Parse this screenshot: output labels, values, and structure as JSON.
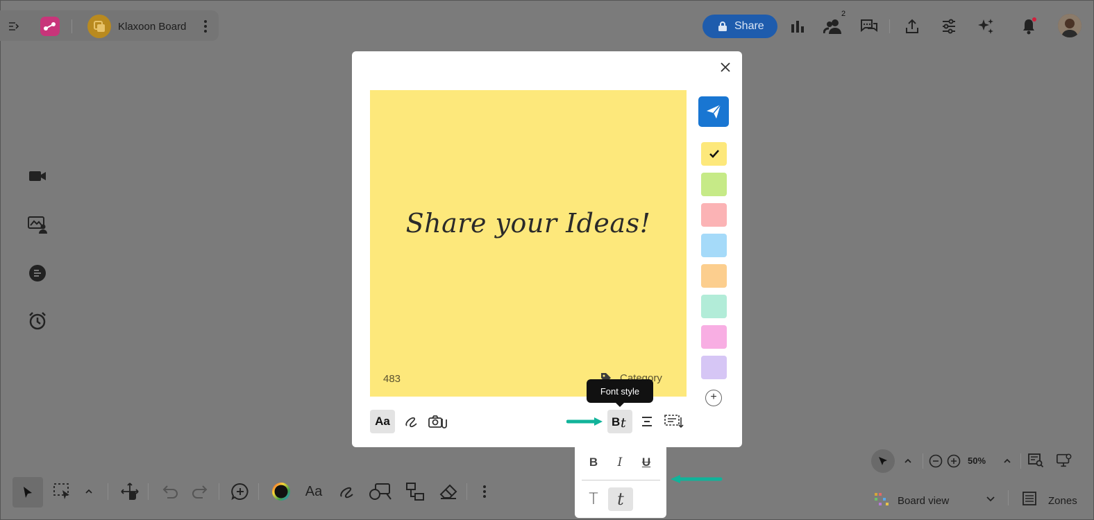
{
  "header": {
    "board_name": "Klaxoon Board",
    "share_label": "Share",
    "participants_count": "2"
  },
  "modal": {
    "sticky_text": "Share your Ideas!",
    "char_counter": "483",
    "category_label": "Category",
    "tooltip": "Font style",
    "text_button_label": "Aa",
    "colors": [
      "#fde87b",
      "#c6ea87",
      "#fbb3b5",
      "#a5daf9",
      "#fcce8e",
      "#b2ecd8",
      "#f8aee3",
      "#d6c6f5"
    ],
    "selected_color_index": 0
  },
  "font_popup": {
    "bold": "B",
    "italic": "I",
    "underline": "U",
    "normal_font": "T",
    "handwritten_font": "t"
  },
  "bottom_toolbar": {
    "text_label": "Aa"
  },
  "bottom_right": {
    "zoom": "50%",
    "view_label": "Board view",
    "zones_label": "Zones"
  },
  "colors": {
    "accent_blue": "#1976d2",
    "share_blue": "#1e5cad",
    "teal_arrow": "#11b39a"
  }
}
